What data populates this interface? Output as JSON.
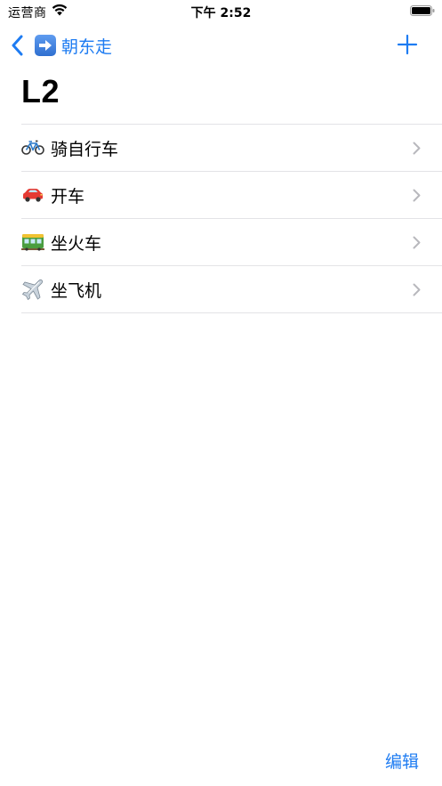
{
  "status_bar": {
    "carrier": "运营商",
    "time": "下午 2:52",
    "icons": [
      "wifi-icon",
      "battery-icon"
    ]
  },
  "nav": {
    "back_label": "朝东走",
    "back_icon": "right-arrow-icon",
    "add_icon": "plus-icon",
    "accent_color": "#1e7cf2"
  },
  "title": "L2",
  "list": {
    "items": [
      {
        "icon": "bicycle-icon",
        "label": "骑自行车"
      },
      {
        "icon": "car-icon",
        "label": "开车"
      },
      {
        "icon": "tram-icon",
        "label": "坐火车"
      },
      {
        "icon": "airplane-icon",
        "label": "坐飞机"
      }
    ]
  },
  "toolbar": {
    "edit_label": "编辑"
  }
}
